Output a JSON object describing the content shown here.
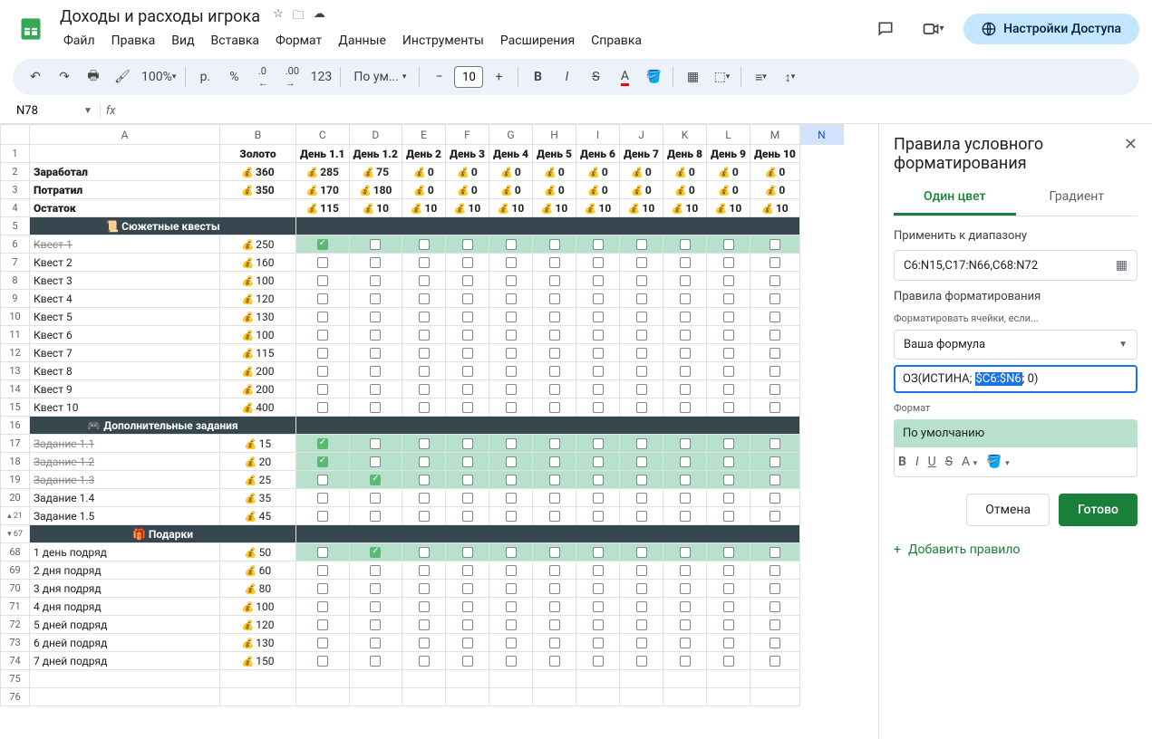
{
  "doc": {
    "title": "Доходы и расходы игрока"
  },
  "menus": [
    "Файл",
    "Правка",
    "Вид",
    "Вставка",
    "Формат",
    "Данные",
    "Инструменты",
    "Расширения",
    "Справка"
  ],
  "share": "Настройки Доступа",
  "toolbar": {
    "zoom": "100%",
    "currency": "р.",
    "percent": "%",
    "dec_dec": ".0",
    "dec_inc": ".00",
    "num": "123",
    "font": "По ум...",
    "fontsize": "10"
  },
  "namebox": "N78",
  "cols": [
    "A",
    "B",
    "C",
    "D",
    "E",
    "F",
    "G",
    "H",
    "I",
    "J",
    "K",
    "L",
    "M",
    "N"
  ],
  "hdr": {
    "gold": "Золото",
    "days": [
      "День 1.1",
      "День 1.2",
      "День 2",
      "День 3",
      "День 4",
      "День 5",
      "День 6",
      "День 7",
      "День 8",
      "День 9",
      "День 10"
    ]
  },
  "summary": [
    {
      "label": "Заработал",
      "gold": 360,
      "vals": [
        285,
        75,
        0,
        0,
        0,
        0,
        0,
        0,
        0,
        0,
        0
      ]
    },
    {
      "label": "Потратил",
      "gold": 350,
      "vals": [
        170,
        180,
        0,
        0,
        0,
        0,
        0,
        0,
        0,
        0,
        0
      ]
    },
    {
      "label": "Остаток",
      "gold": "",
      "vals": [
        115,
        10,
        10,
        10,
        10,
        10,
        10,
        10,
        10,
        10,
        10
      ]
    }
  ],
  "sections": [
    {
      "title": "📜 Сюжетные квесты",
      "rows_start": 6,
      "items": [
        {
          "n": 6,
          "name": "Квест 1",
          "gold": 250,
          "strike": true,
          "hl": true,
          "checks": [
            1,
            0,
            0,
            0,
            0,
            0,
            0,
            0,
            0,
            0,
            0
          ]
        },
        {
          "n": 7,
          "name": "Квест 2",
          "gold": 160
        },
        {
          "n": 8,
          "name": "Квест 3",
          "gold": 100
        },
        {
          "n": 9,
          "name": "Квест 4",
          "gold": 120
        },
        {
          "n": 10,
          "name": "Квест 5",
          "gold": 130
        },
        {
          "n": 11,
          "name": "Квест 6",
          "gold": 100
        },
        {
          "n": 12,
          "name": "Квест 7",
          "gold": 115
        },
        {
          "n": 13,
          "name": "Квест 8",
          "gold": 200
        },
        {
          "n": 14,
          "name": "Квест 9",
          "gold": 200
        },
        {
          "n": 15,
          "name": "Квест 10",
          "gold": 400
        }
      ]
    },
    {
      "title": "🎮 Дополнительные задания",
      "rows_start": 17,
      "header_row": 16,
      "items": [
        {
          "n": 17,
          "name": "Задание 1.1",
          "gold": 15,
          "strike": true,
          "hl": true,
          "checks": [
            1,
            0,
            0,
            0,
            0,
            0,
            0,
            0,
            0,
            0,
            0
          ]
        },
        {
          "n": 18,
          "name": "Задание 1.2",
          "gold": 20,
          "strike": true,
          "hl": true,
          "checks": [
            1,
            0,
            0,
            0,
            0,
            0,
            0,
            0,
            0,
            0,
            0
          ]
        },
        {
          "n": 19,
          "name": "Задание 1.3",
          "gold": 25,
          "strike": true,
          "hl": true,
          "checks": [
            0,
            1,
            0,
            0,
            0,
            0,
            0,
            0,
            0,
            0,
            0
          ]
        },
        {
          "n": 20,
          "name": "Задание 1.4",
          "gold": 35
        },
        {
          "n": 21,
          "name": "Задание 1.5",
          "gold": 45,
          "collapse": true
        }
      ]
    },
    {
      "title": "🎁 Подарки",
      "rows_start": 68,
      "header_row": 67,
      "collapse_header": true,
      "items": [
        {
          "n": 68,
          "name": "1 день подряд",
          "gold": 50,
          "hl": true,
          "checks": [
            0,
            1,
            0,
            0,
            0,
            0,
            0,
            0,
            0,
            0,
            0
          ]
        },
        {
          "n": 69,
          "name": "2 дня подряд",
          "gold": 60
        },
        {
          "n": 70,
          "name": "3 дня подряд",
          "gold": 80
        },
        {
          "n": 71,
          "name": "4 дня подряд",
          "gold": 100
        },
        {
          "n": 72,
          "name": "5 дней подряд",
          "gold": 120
        },
        {
          "n": 73,
          "name": "6 дней подряд",
          "gold": 130
        },
        {
          "n": 74,
          "name": "7 дней подряд",
          "gold": 150
        }
      ]
    }
  ],
  "tail_rows": [
    75,
    76
  ],
  "panel": {
    "title": "Правила условного форматирования",
    "tab1": "Один цвет",
    "tab2": "Градиент",
    "apply_label": "Применить к диапазону",
    "range": "C6:N15,C17:N66,C68:N72",
    "rules_label": "Правила форматирования",
    "format_if": "Форматировать ячейки, если...",
    "formula_opt": "Ваша формула",
    "formula_pre": "ОЗ(ИСТИНА; ",
    "formula_sel": "$C6:$N6",
    "formula_post": "; 0)",
    "format_label": "Формат",
    "preview": "По умолчанию",
    "cancel": "Отмена",
    "done": "Готово",
    "add_rule": "Добавить правило"
  }
}
